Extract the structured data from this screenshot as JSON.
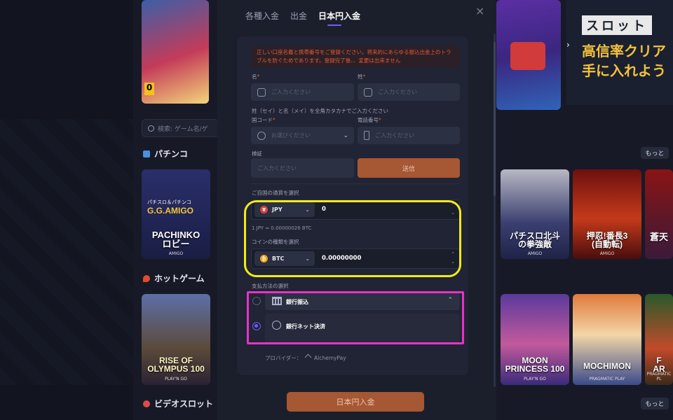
{
  "background": {
    "search_placeholder": "検索: ゲーム名/ゲ",
    "sections": [
      {
        "title": "パチンコ",
        "more": "もっと"
      },
      {
        "title": "ホットゲーム"
      },
      {
        "title": "ビデオスロット",
        "more": "もっと"
      }
    ],
    "banner": {
      "tag": "スロット",
      "line1": "高信率クリア",
      "line2": "手に入れよう"
    },
    "games": [
      {
        "title": "PACHINKO\nロビー",
        "provider": "AMIGO",
        "logo": "G.G.AMIGO",
        "sublogo": "パチスロ＆パチンコ"
      },
      {
        "title": "パチスロ北斗\nの拳強敵",
        "provider": "AMIGO"
      },
      {
        "title": "押忍!番長3\n(自動転)",
        "provider": "AMIGO"
      },
      {
        "title": "蒼天",
        "provider": ""
      },
      {
        "title": "RISE OF\nOLYMPUS 100",
        "provider": "PLAY'N GO"
      },
      {
        "title": "MOON\nPRINCESS 100",
        "provider": "PLAY'N GO"
      },
      {
        "title": "MOCHIMON",
        "provider": "PRAGMATIC PLAY"
      },
      {
        "title": "F\nAR",
        "provider": "PRAGMATIC PL"
      }
    ]
  },
  "modal": {
    "tabs": [
      "各種入金",
      "出金",
      "日本円入金"
    ],
    "warning": "正しい口座名義と携帯番号をご登録ください。将来的にあらゆる振込出金上のトラブルを防ぐためであります。登録完了後、、変更は出来ません",
    "last_name_label": "名",
    "first_name_label": "姓",
    "required_mark": "*",
    "name_placeholder": "ご入力ください",
    "katakana_hint": "姓（セイ）と名（メイ）を全角カタカナでご入力ください",
    "country_label": "国コード",
    "country_placeholder": "お選びください",
    "phone_label": "電話番号",
    "phone_placeholder": "ご入力ください",
    "verify_label": "検証",
    "verify_placeholder": "ご入力ください",
    "send_button": "送信",
    "currency_label": "ご自国の通貨を選択",
    "fiat_currency": "JPY",
    "fiat_symbol": "¥",
    "fiat_amount": "0",
    "rate_text": "1 JPY ≈ 0.00000026 BTC",
    "coin_label": "コインの種類を選択",
    "coin_currency": "BTC",
    "coin_symbol": "₿",
    "coin_amount": "0.00000000",
    "pay_method_label": "支払方法の選択",
    "pay_methods": [
      "銀行振込",
      "銀行ネット決済"
    ],
    "provider_label": "プロバイダー：",
    "provider_name": "AlchemyPay",
    "submit_button": "日本円入金",
    "close": "×"
  },
  "colors": {
    "accent": "#6e5cff",
    "cta": "#a65733",
    "warning": "#e8572e",
    "highlight_yellow": "#f2ec16",
    "highlight_pink": "#e832c8"
  }
}
